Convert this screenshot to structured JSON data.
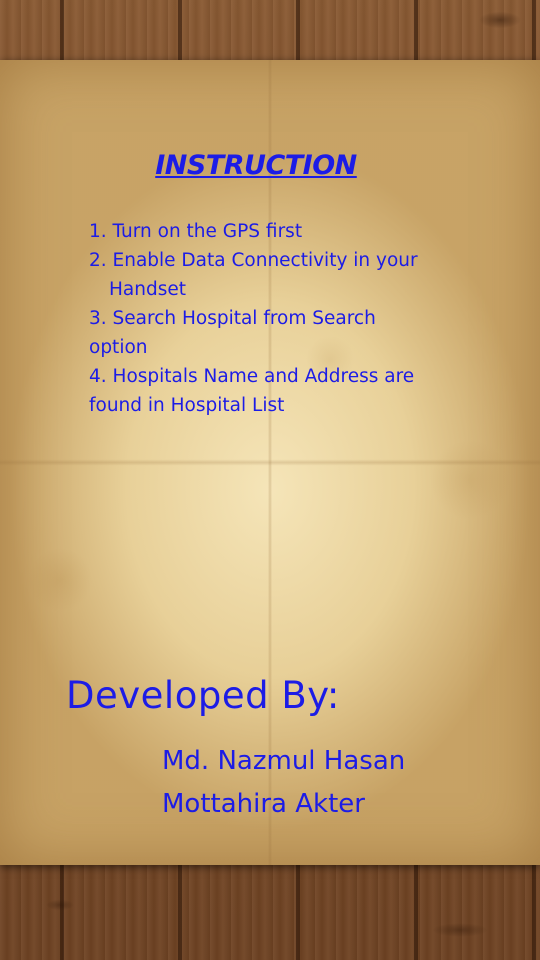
{
  "title": "INSTRUCTION",
  "instructions": [
    {
      "line1": "1. Turn on the GPS first",
      "line2": ""
    },
    {
      "line1": "2. Enable Data Connectivity in your",
      "line2": "Handset"
    },
    {
      "line1": "3. Search Hospital from Search",
      "line2": "option"
    },
    {
      "line1": "4. Hospitals Name and Address are",
      "line2": "found in Hospital List"
    }
  ],
  "developed_by_label": "Developed By:",
  "developers": [
    "Md. Nazmul Hasan",
    "Mottahira Akter"
  ],
  "colors": {
    "text": "#1c1ce6",
    "paper": "#e6cf9a",
    "wood": "#7a4b28"
  }
}
